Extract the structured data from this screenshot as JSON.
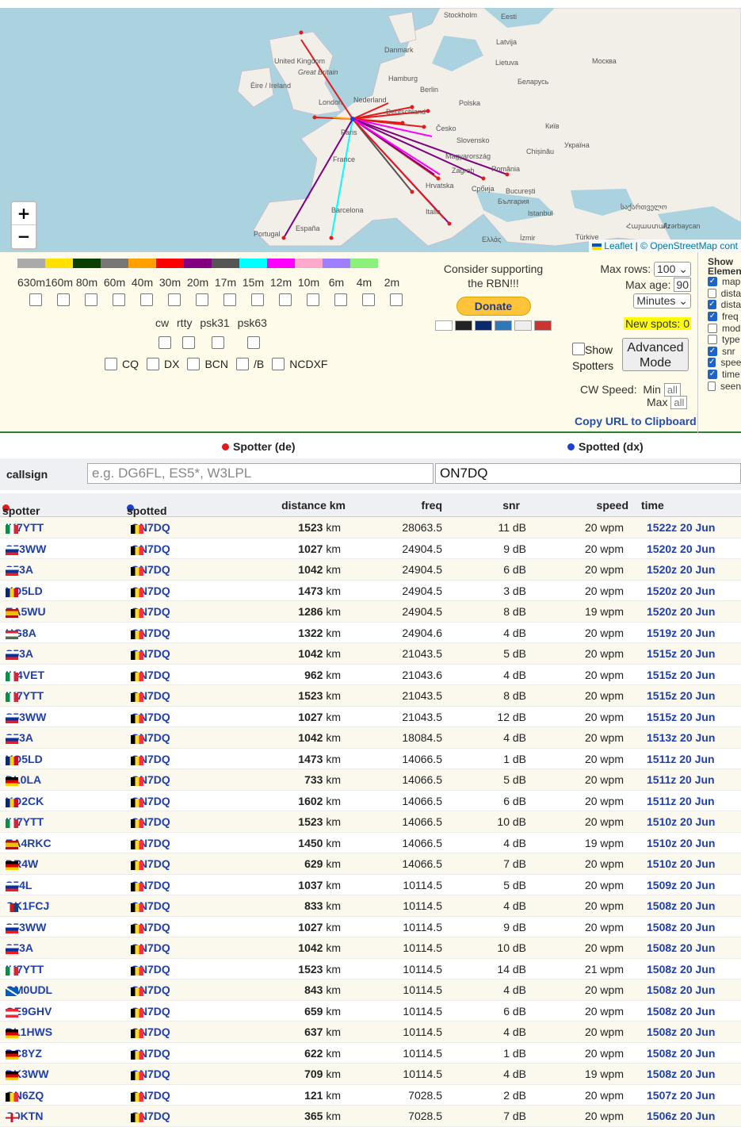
{
  "map": {
    "zoom_in": "+",
    "zoom_out": "−",
    "attribution_leaflet": "Leaflet",
    "attribution_osm": "© OpenStreetMap cont",
    "labels": [
      "Stockholm",
      "Eesti",
      "Latvija",
      "Danmark",
      "Lietuva",
      "Москва",
      "United Kingdom",
      "Great Britain",
      "Éire / Ireland",
      "Hamburg",
      "Berlin",
      "Беларусь",
      "Nederland",
      "London",
      "Deutschland",
      "Polska",
      "Paris",
      "Česko",
      "Київ",
      "Slovensko",
      "Україна",
      "Chișinău",
      "Magyarország",
      "France",
      "Zagreb",
      "România",
      "Hrvatska",
      "Србија",
      "București",
      "България",
      "Barcelona",
      "Italia",
      "Istanbul",
      "Portugal",
      "España",
      "Ελλάς",
      "İzmir",
      "Türkiye",
      "საქართველო",
      "Azərbaycan",
      "Հայաստան"
    ]
  },
  "bands": {
    "colors": [
      "#aaaaaa",
      "#ffe000",
      "#093f00",
      "#777777",
      "#ff9f00",
      "#ff0000",
      "#800080",
      "#555555",
      "#00ffff",
      "#ff00ff",
      "#ffaacc",
      "#9f7fff",
      "#8cf07c"
    ],
    "labels": [
      "630m",
      "160m",
      "80m",
      "60m",
      "40m",
      "30m",
      "20m",
      "17m",
      "15m",
      "12m",
      "10m",
      "6m",
      "4m",
      "2m"
    ],
    "modes": [
      "cw",
      "rtty",
      "psk31",
      "psk63"
    ],
    "filters": [
      "CQ",
      "DX",
      "BCN",
      "/B",
      "NCDXF"
    ]
  },
  "donate": {
    "text1": "Consider supporting",
    "text2": "the RBN!!!",
    "button": "Donate"
  },
  "options": {
    "max_rows_label": "Max rows:",
    "max_rows_value": "100",
    "max_age_label": "Max age:",
    "max_age_value": "90",
    "age_unit": "Minutes",
    "new_spots": "New spots: 0",
    "show_spotters_1": "Show",
    "show_spotters_2": "Spotters",
    "advanced_1": "Advanced",
    "advanced_2": "Mode",
    "cw_speed_label": "CW Speed:",
    "min_label": "Min",
    "min_value": "all",
    "max_label": "Max",
    "max_value": "all",
    "copy_url": "Copy URL to Clipboard"
  },
  "show_elements": {
    "header1": "Show",
    "header2": "Elemen",
    "items": [
      {
        "label": "map",
        "checked": true
      },
      {
        "label": "dista",
        "checked": false
      },
      {
        "label": "dista",
        "checked": true
      },
      {
        "label": "freq",
        "checked": true
      },
      {
        "label": "mod",
        "checked": false
      },
      {
        "label": "type",
        "checked": false
      },
      {
        "label": "snr",
        "checked": true
      },
      {
        "label": "spee",
        "checked": true
      },
      {
        "label": "time",
        "checked": true
      },
      {
        "label": "seen",
        "checked": false
      }
    ]
  },
  "table": {
    "spotter_de": "Spotter (de)",
    "spotted_dx": "Spotted (dx)",
    "callsign_label": "callsign",
    "spotter_placeholder": "e.g. DG6FL, ES5*, W3LPL",
    "spotted_value": "ON7DQ",
    "headers": {
      "spotter": "spotter",
      "spotted": "spotted",
      "distance": "distance km",
      "freq": "freq",
      "snr": "snr",
      "speed": "speed",
      "time": "time"
    },
    "rows": [
      {
        "sp": "IK7YTT",
        "f": "it",
        "dx": "ON7DQ",
        "dist": "1523",
        "freq": "28063.5",
        "snr": "11 dB",
        "speed": "20 wpm",
        "time": "1522z 20 Jun"
      },
      {
        "sp": "S53WW",
        "f": "si",
        "dx": "ON7DQ",
        "dist": "1027",
        "freq": "24904.5",
        "snr": "9 dB",
        "speed": "20 wpm",
        "time": "1520z 20 Jun"
      },
      {
        "sp": "S53A",
        "f": "si",
        "dx": "ON7DQ",
        "dist": "1042",
        "freq": "24904.5",
        "snr": "6 dB",
        "speed": "20 wpm",
        "time": "1520z 20 Jun"
      },
      {
        "sp": "YO5LD",
        "f": "ro",
        "dx": "ON7DQ",
        "dist": "1473",
        "freq": "24904.5",
        "snr": "3 dB",
        "speed": "20 wpm",
        "time": "1520z 20 Jun"
      },
      {
        "sp": "EA5WU",
        "f": "es",
        "dx": "ON7DQ",
        "dist": "1286",
        "freq": "24904.5",
        "snr": "8 dB",
        "speed": "19 wpm",
        "time": "1520z 20 Jun"
      },
      {
        "sp": "HG8A",
        "f": "hu",
        "dx": "ON7DQ",
        "dist": "1322",
        "freq": "24904.6",
        "snr": "4 dB",
        "speed": "20 wpm",
        "time": "1519z 20 Jun"
      },
      {
        "sp": "S53A",
        "f": "si",
        "dx": "ON7DQ",
        "dist": "1042",
        "freq": "21043.5",
        "snr": "5 dB",
        "speed": "20 wpm",
        "time": "1515z 20 Jun"
      },
      {
        "sp": "IK4VET",
        "f": "it",
        "dx": "ON7DQ",
        "dist": "962",
        "freq": "21043.6",
        "snr": "4 dB",
        "speed": "20 wpm",
        "time": "1515z 20 Jun"
      },
      {
        "sp": "IK7YTT",
        "f": "it",
        "dx": "ON7DQ",
        "dist": "1523",
        "freq": "21043.5",
        "snr": "8 dB",
        "speed": "20 wpm",
        "time": "1515z 20 Jun"
      },
      {
        "sp": "S53WW",
        "f": "si",
        "dx": "ON7DQ",
        "dist": "1027",
        "freq": "21043.5",
        "snr": "12 dB",
        "speed": "20 wpm",
        "time": "1515z 20 Jun"
      },
      {
        "sp": "S53A",
        "f": "si",
        "dx": "ON7DQ",
        "dist": "1042",
        "freq": "18084.5",
        "snr": "4 dB",
        "speed": "20 wpm",
        "time": "1513z 20 Jun"
      },
      {
        "sp": "YO5LD",
        "f": "ro",
        "dx": "ON7DQ",
        "dist": "1473",
        "freq": "14066.5",
        "snr": "1 dB",
        "speed": "20 wpm",
        "time": "1511z 20 Jun"
      },
      {
        "sp": "DL0LA",
        "f": "de",
        "dx": "ON7DQ",
        "dist": "733",
        "freq": "14066.5",
        "snr": "5 dB",
        "speed": "20 wpm",
        "time": "1511z 20 Jun"
      },
      {
        "sp": "YO2CK",
        "f": "ro",
        "dx": "ON7DQ",
        "dist": "1602",
        "freq": "14066.5",
        "snr": "6 dB",
        "speed": "20 wpm",
        "time": "1511z 20 Jun"
      },
      {
        "sp": "IK7YTT",
        "f": "it",
        "dx": "ON7DQ",
        "dist": "1523",
        "freq": "14066.5",
        "snr": "10 dB",
        "speed": "20 wpm",
        "time": "1510z 20 Jun"
      },
      {
        "sp": "EA4RKC",
        "f": "es",
        "dx": "ON7DQ",
        "dist": "1450",
        "freq": "14066.5",
        "snr": "4 dB",
        "speed": "19 wpm",
        "time": "1510z 20 Jun"
      },
      {
        "sp": "DR4W",
        "f": "de",
        "dx": "ON7DQ",
        "dist": "629",
        "freq": "14066.5",
        "snr": "7 dB",
        "speed": "20 wpm",
        "time": "1510z 20 Jun"
      },
      {
        "sp": "S54L",
        "f": "si",
        "dx": "ON7DQ",
        "dist": "1037",
        "freq": "10114.5",
        "snr": "5 dB",
        "speed": "20 wpm",
        "time": "1509z 20 Jun"
      },
      {
        "sp": "OK1FCJ",
        "f": "cz",
        "dx": "ON7DQ",
        "dist": "833",
        "freq": "10114.5",
        "snr": "4 dB",
        "speed": "20 wpm",
        "time": "1508z 20 Jun"
      },
      {
        "sp": "S53WW",
        "f": "si",
        "dx": "ON7DQ",
        "dist": "1027",
        "freq": "10114.5",
        "snr": "9 dB",
        "speed": "20 wpm",
        "time": "1508z 20 Jun"
      },
      {
        "sp": "S53A",
        "f": "si",
        "dx": "ON7DQ",
        "dist": "1042",
        "freq": "10114.5",
        "snr": "10 dB",
        "speed": "20 wpm",
        "time": "1508z 20 Jun"
      },
      {
        "sp": "IK7YTT",
        "f": "it",
        "dx": "ON7DQ",
        "dist": "1523",
        "freq": "10114.5",
        "snr": "14 dB",
        "speed": "21 wpm",
        "time": "1508z 20 Jun"
      },
      {
        "sp": "GM0UDL",
        "f": "sc",
        "dx": "ON7DQ",
        "dist": "843",
        "freq": "10114.5",
        "snr": "4 dB",
        "speed": "20 wpm",
        "time": "1508z 20 Jun"
      },
      {
        "sp": "OE9GHV",
        "f": "at",
        "dx": "ON7DQ",
        "dist": "659",
        "freq": "10114.5",
        "snr": "6 dB",
        "speed": "20 wpm",
        "time": "1508z 20 Jun"
      },
      {
        "sp": "DL1HWS",
        "f": "de",
        "dx": "ON7DQ",
        "dist": "637",
        "freq": "10114.5",
        "snr": "4 dB",
        "speed": "20 wpm",
        "time": "1508z 20 Jun"
      },
      {
        "sp": "DC8YZ",
        "f": "de",
        "dx": "ON7DQ",
        "dist": "622",
        "freq": "10114.5",
        "snr": "1 dB",
        "speed": "20 wpm",
        "time": "1508z 20 Jun"
      },
      {
        "sp": "DK3WW",
        "f": "de",
        "dx": "ON7DQ",
        "dist": "709",
        "freq": "10114.5",
        "snr": "4 dB",
        "speed": "19 wpm",
        "time": "1508z 20 Jun"
      },
      {
        "sp": "ON6ZQ",
        "f": "be",
        "dx": "ON7DQ",
        "dist": "121",
        "freq": "7028.5",
        "snr": "2 dB",
        "speed": "20 wpm",
        "time": "1507z 20 Jun"
      },
      {
        "sp": "G0KTN",
        "f": "en",
        "dx": "ON7DQ",
        "dist": "365",
        "freq": "7028.5",
        "snr": "7 dB",
        "speed": "20 wpm",
        "time": "1506z 20 Jun"
      }
    ],
    "km": "km"
  },
  "flag_colors": {
    "it": [
      "#009246",
      "#ffffff",
      "#ce2b37"
    ],
    "si": [
      "#ffffff",
      "#0033a0",
      "#ed1c24"
    ],
    "ro": [
      "#002b7f",
      "#fcd116",
      "#ce1126"
    ],
    "es": [
      "#aa151b",
      "#f1bf00",
      "#aa151b"
    ],
    "hu": [
      "#ce2939",
      "#ffffff",
      "#477050"
    ],
    "de": [
      "#000000",
      "#dd0000",
      "#ffce00"
    ],
    "cz": [
      "#ffffff",
      "#d7141a",
      "#11457e"
    ],
    "at": [
      "#ed2939",
      "#ffffff",
      "#ed2939"
    ],
    "be": [
      "#000000",
      "#fdda24",
      "#ef3340"
    ],
    "sc": [
      "#005eb8",
      "#ffffff",
      "#005eb8"
    ],
    "en": [
      "#ffffff",
      "#ce1124",
      "#ffffff"
    ]
  }
}
